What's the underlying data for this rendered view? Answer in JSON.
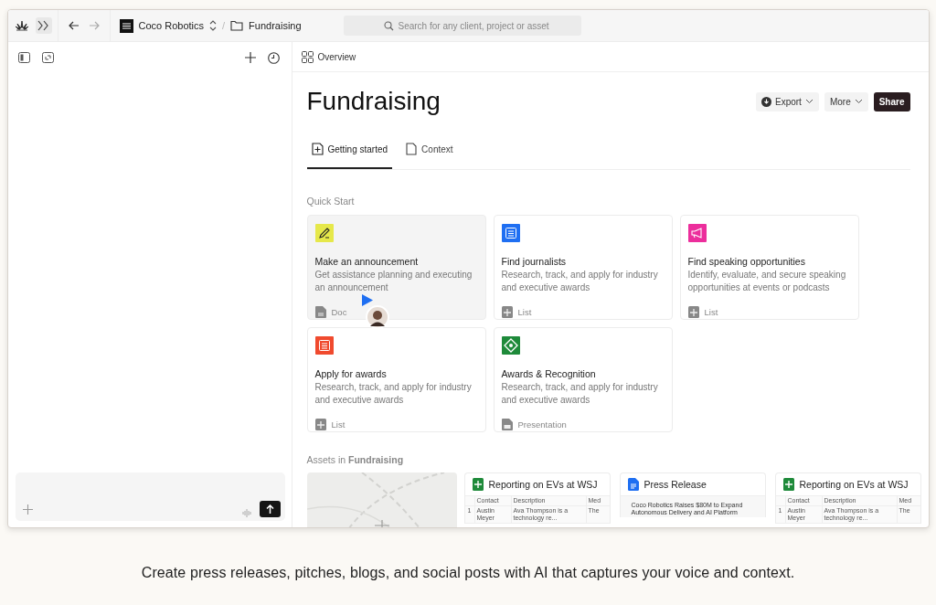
{
  "topbar": {
    "breadcrumb": [
      {
        "kind": "workspace",
        "label": "Coco Robotics"
      },
      {
        "kind": "folder",
        "label": "Fundraising"
      }
    ],
    "separator": "/",
    "search": {
      "placeholder": "Search for any client, project or asset"
    }
  },
  "page": {
    "view_label": "Overview",
    "title": "Fundraising",
    "actions": [
      {
        "kind": "export",
        "label": "Export"
      },
      {
        "kind": "menu",
        "label": "More"
      },
      {
        "kind": "primary",
        "label": "Share"
      }
    ],
    "tabs": [
      {
        "kind": "new",
        "label": "Getting started",
        "selected": true
      },
      {
        "kind": "file",
        "label": "Context",
        "selected": false
      }
    ]
  },
  "quick_start": {
    "heading": "Quick Start",
    "cards": [
      {
        "kind": "pen",
        "color": "#e6e84a",
        "title": "Make an announcement",
        "description": "Get assistance planning and executing an announcement",
        "type": {
          "kind": "doc",
          "label": "Doc"
        },
        "hovered": true
      },
      {
        "kind": "list",
        "color": "#1f6ff2",
        "title": "Find journalists",
        "description": "Research, track, and apply for industry and executive awards",
        "type": {
          "kind": "list",
          "label": "List"
        },
        "hovered": false
      },
      {
        "kind": "megaphone",
        "color": "#ec2e9c",
        "title": "Find speaking opportunities",
        "description": "Identify, evaluate, and secure speaking opportunities at events or podcasts",
        "type": {
          "kind": "list",
          "label": "List"
        },
        "hovered": false
      },
      {
        "kind": "list",
        "color": "#f04a2e",
        "title": "Apply for awards",
        "description": "Research, track, and apply for industry and executive awards",
        "type": {
          "kind": "list",
          "label": "List"
        },
        "hovered": false
      },
      {
        "kind": "diamond",
        "color": "#1e8a3a",
        "title": "Awards & Recognition",
        "description": "Research, track, and apply for industry and executive awards",
        "type": {
          "kind": "presentation",
          "label": "Presentation"
        },
        "hovered": false
      }
    ]
  },
  "assets": {
    "heading": "Assets in **Fundraising**",
    "items": [
      {
        "kind": "picture"
      },
      {
        "kind": "sheet",
        "title": "Reporting on EVs at WSJ",
        "columns": [
          "Contact",
          "Description",
          "Med"
        ],
        "rows": [
          {
            "number": "1",
            "cells": [
              "Austin Meyer",
              "Ava Thompson is a technology re...",
              "The"
            ]
          }
        ]
      },
      {
        "kind": "doc",
        "title": "Press Release",
        "text": "Coco Robotics Raises $80M to Expand Autonomous Delivery and AI Platform"
      },
      {
        "kind": "sheet",
        "title": "Reporting on EVs at WSJ",
        "columns": [
          "Contact",
          "Description",
          "Med"
        ],
        "rows": [
          {
            "number": "1",
            "cells": [
              "Austin Meyer",
              "Ava Thompson is a technology re...",
              "The"
            ]
          }
        ]
      }
    ]
  },
  "caption": "Create press releases, pitches, blogs, and social posts with AI that captures your voice and context."
}
